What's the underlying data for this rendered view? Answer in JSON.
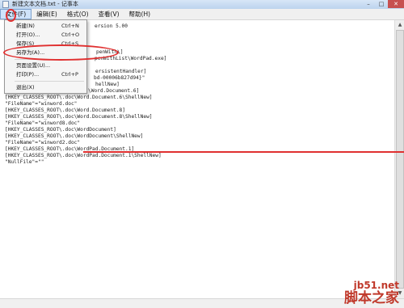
{
  "window": {
    "title": "新建文本文档.txt - 记事本",
    "controls": {
      "minimize": "–",
      "maximize": "□",
      "close": "✕"
    }
  },
  "menubar": {
    "items": [
      {
        "label": "文件(F)",
        "active": true
      },
      {
        "label": "编辑(E)"
      },
      {
        "label": "格式(O)"
      },
      {
        "label": "查看(V)"
      },
      {
        "label": "帮助(H)"
      }
    ]
  },
  "file_menu": {
    "items": [
      {
        "label": "新建(N)",
        "shortcut": "Ctrl+N"
      },
      {
        "label": "打开(O)...",
        "shortcut": "Ctrl+O"
      },
      {
        "label": "保存(S)",
        "shortcut": "Ctrl+S"
      },
      {
        "label": "另存为(A)..."
      },
      {
        "label": "页面设置(U)..."
      },
      {
        "label": "打印(P)...",
        "shortcut": "Ctrl+P"
      },
      {
        "label": "退出(X)"
      }
    ]
  },
  "editor": {
    "lines": [
      "ersion 5.00",
      "",
      "",
      "penWith\\]",
      "penWithList\\WordPad.exe]",
      "",
      "ersistentHandler]",
      "bd-00006b827d94}\"",
      "hellNew]",
      "\\Word.Document.6]",
      "[HKEY_CLASSES_ROOT\\.doc\\Word.Document.6\\ShellNew]",
      "\"FileName\"=\"winword.doc\"",
      "[HKEY_CLASSES_ROOT\\.doc\\Word.Document.8]",
      "[HKEY_CLASSES_ROOT\\.doc\\Word.Document.8\\ShellNew]",
      "\"FileName\"=\"winword8.doc\"",
      "[HKEY_CLASSES_ROOT\\.doc\\WordDocument]",
      "[HKEY_CLASSES_ROOT\\.doc\\WordDocument\\ShellNew]",
      "\"FileName\"=\"winword2.doc\"",
      "[HKEY_CLASSES_ROOT\\.doc\\WordPad.Document.1]",
      "[HKEY_CLASSES_ROOT\\.doc\\WordPad.Document.1\\ShellNew]",
      "\"NullFile\"=\"\""
    ]
  },
  "scrollbar": {
    "up_arrow": "▲",
    "down_arrow": "▼"
  },
  "watermark": {
    "url": "jb51.net",
    "name": "脚本之家"
  },
  "colors": {
    "annotation_red": "#e03030",
    "watermark_red": "#c0392b"
  }
}
